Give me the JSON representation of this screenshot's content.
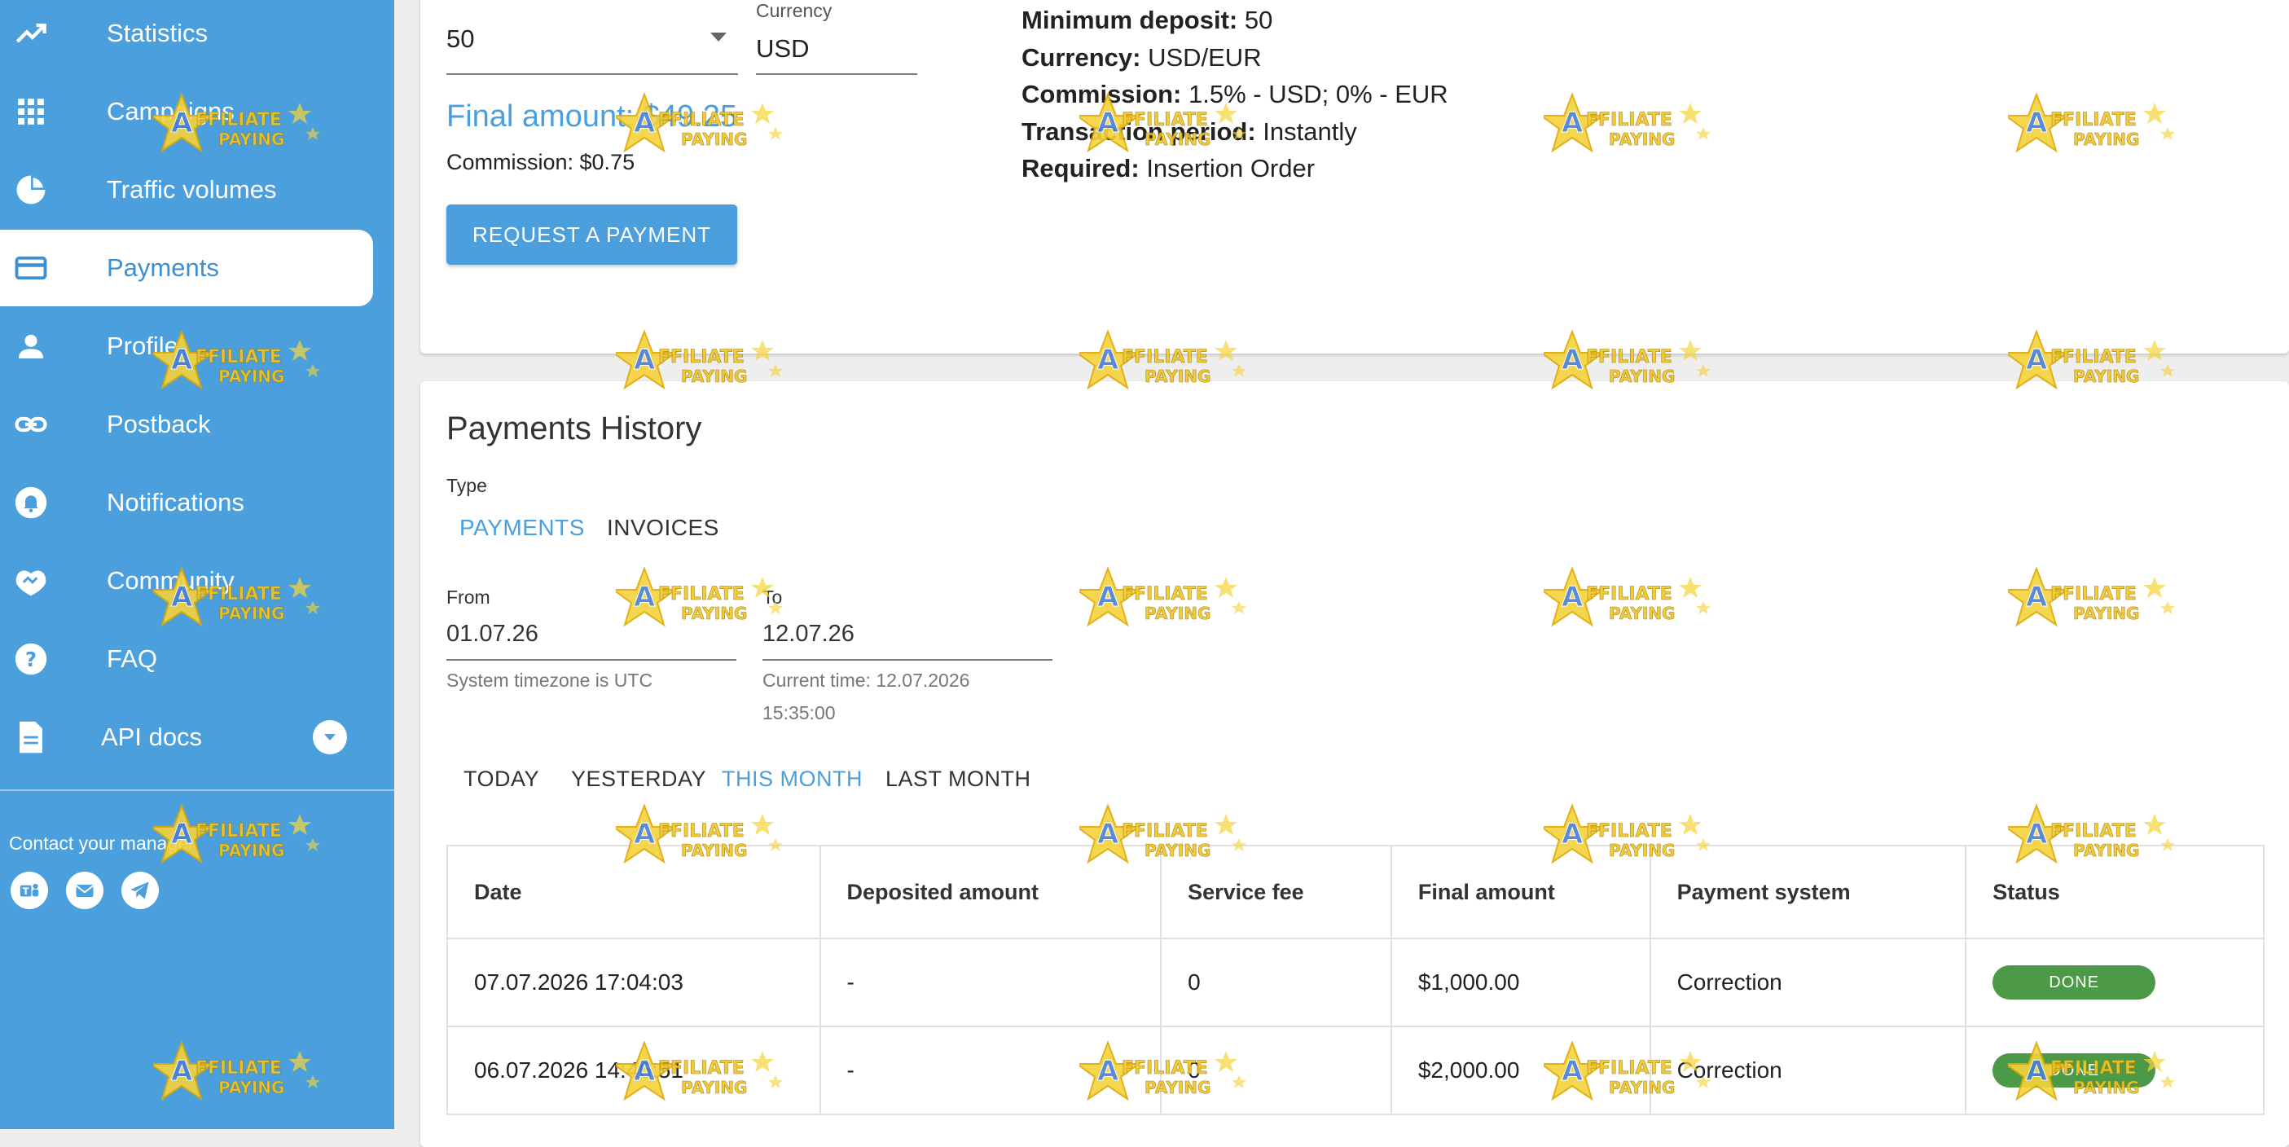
{
  "sidebar": {
    "items": [
      {
        "label": "Statistics",
        "icon": "trending-up-icon"
      },
      {
        "label": "Campaigns",
        "icon": "grid-icon"
      },
      {
        "label": "Traffic volumes",
        "icon": "pie-chart-icon"
      },
      {
        "label": "Payments",
        "icon": "credit-card-icon",
        "active": true
      },
      {
        "label": "Profile",
        "icon": "person-icon"
      },
      {
        "label": "Postback",
        "icon": "link-icon"
      },
      {
        "label": "Notifications",
        "icon": "bell-icon"
      },
      {
        "label": "Community",
        "icon": "handshake-icon"
      },
      {
        "label": "FAQ",
        "icon": "help-icon"
      },
      {
        "label": "API docs",
        "icon": "document-icon"
      }
    ],
    "contact_label": "Contact your manager",
    "contact_icons": [
      "teams-icon",
      "mail-icon",
      "telegram-icon"
    ]
  },
  "payment_request": {
    "amount_value": "50",
    "currency_label": "Currency",
    "currency_value": "USD",
    "final_amount": "Final amount: $49.25",
    "commission": "Commission: $0.75",
    "request_button": "REQUEST A PAYMENT",
    "info": {
      "min_deposit_label": "Minimum deposit:",
      "min_deposit_value": "50",
      "currency_label": "Currency:",
      "currency_value": "USD/EUR",
      "commission_label": "Commission:",
      "commission_value": "1.5% - USD; 0% - EUR",
      "period_label": "Transaction period:",
      "period_value": "Instantly",
      "required_label": "Required:",
      "required_value": "Insertion Order"
    }
  },
  "history": {
    "title": "Payments History",
    "type_label": "Type",
    "tabs": [
      "PAYMENTS",
      "INVOICES"
    ],
    "from_label": "From",
    "from_value": "01.07.26",
    "to_label": "To",
    "to_value": "12.07.26",
    "timezone_hint": "System timezone is UTC",
    "current_time_line1": "Current time: 12.07.2026",
    "current_time_line2": "15:35:00",
    "periods": [
      "TODAY",
      "YESTERDAY",
      "THIS MONTH",
      "LAST MONTH"
    ],
    "active_period": "THIS MONTH",
    "columns": [
      "Date",
      "Deposited amount",
      "Service fee",
      "Final amount",
      "Payment system",
      "Status"
    ],
    "rows": [
      {
        "date": "07.07.2026 17:04:03",
        "deposited": "-",
        "fee": "0",
        "final": "$1,000.00",
        "system": "Correction",
        "status": "DONE"
      },
      {
        "date": "06.07.2026 14:46:51",
        "deposited": "-",
        "fee": "0",
        "final": "$2,000.00",
        "system": "Correction",
        "status": "DONE"
      }
    ]
  },
  "colors": {
    "sidebar_bg": "#4a9fdc",
    "accent": "#4a9fdc",
    "status_done": "#4c9a47"
  },
  "watermark_text": [
    "A",
    "FFILIATE",
    "PAYING"
  ]
}
